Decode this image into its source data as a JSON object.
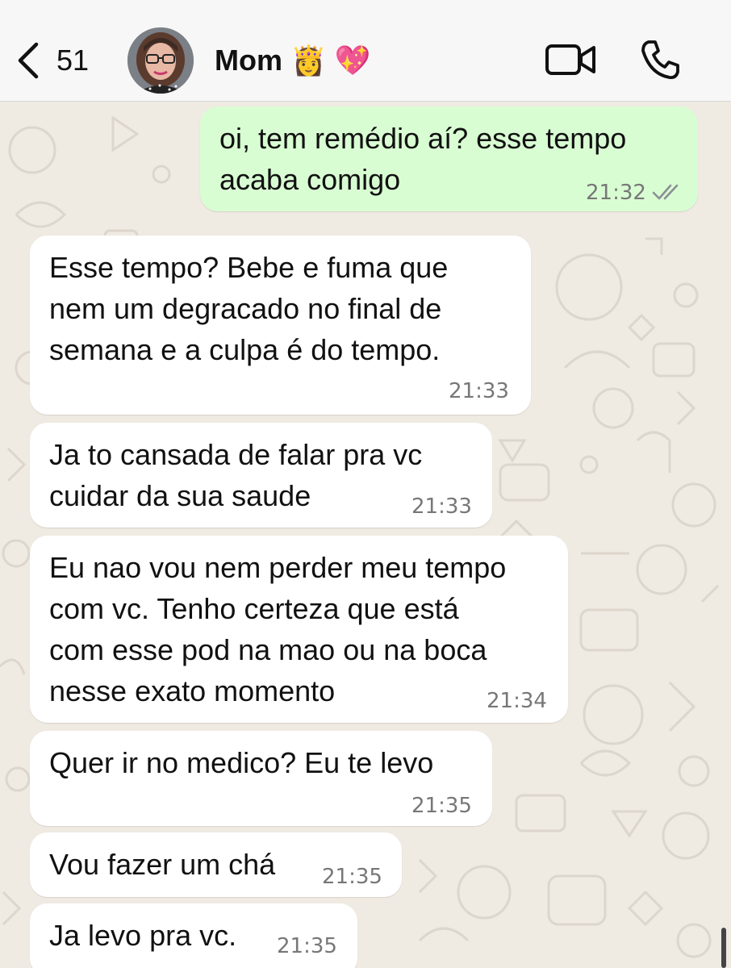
{
  "header": {
    "back_count": "51",
    "contact_name": "Mom 👸 💖"
  },
  "messages": [
    {
      "direction": "out",
      "text": "oi, tem remédio aí? esse tempo\nacaba comigo",
      "time": "21:32",
      "status": "read"
    },
    {
      "direction": "in",
      "text": "Esse tempo? Bebe e fuma que\nnem um degracado no final de\nsemana e a culpa é do tempo.",
      "time": "21:33"
    },
    {
      "direction": "in",
      "text": "Ja to cansada de falar pra vc\ncuidar da sua saude",
      "time": "21:33"
    },
    {
      "direction": "in",
      "text": "Eu nao vou nem perder meu tempo\ncom vc. Tenho certeza que está\ncom esse pod na mao ou na boca\nnesse exato momento",
      "time": "21:34"
    },
    {
      "direction": "in",
      "text": "Quer ir no medico? Eu te levo",
      "time": "21:35"
    },
    {
      "direction": "in",
      "text": "Vou fazer um chá",
      "time": "21:35"
    },
    {
      "direction": "in",
      "text": "Ja levo pra vc.",
      "time": "21:35"
    }
  ],
  "icons": {
    "back": "chevron-left-icon",
    "video": "video-camera-icon",
    "call": "phone-icon",
    "read_status": "double-check-icon"
  },
  "colors": {
    "outgoing_bubble": "#d9fdd3",
    "incoming_bubble": "#ffffff",
    "chat_background": "#efeae2",
    "header_background": "#f7f7f7",
    "read_ticks": "#8a8f94"
  }
}
